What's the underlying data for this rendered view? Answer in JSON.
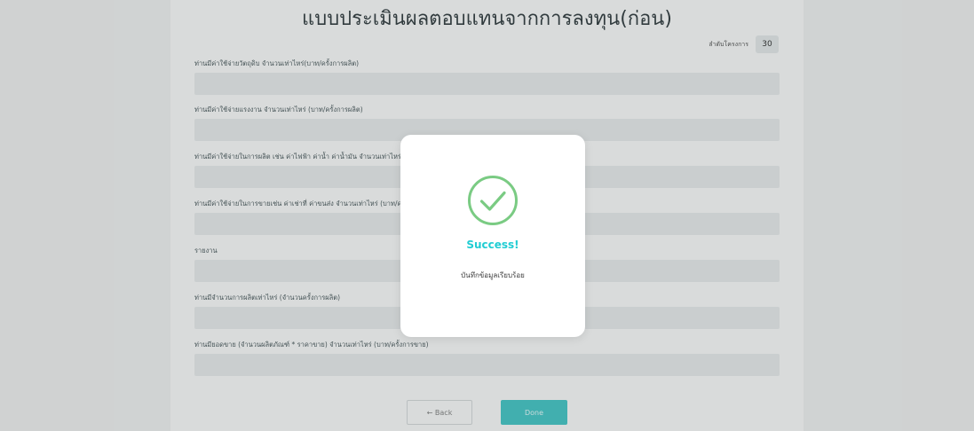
{
  "form": {
    "title": "แบบประเมินผลตอบแทนจากการลงทุน(ก่อน)",
    "order_label": "ลำดับโครงการ",
    "order_value": "30",
    "fields": [
      {
        "label": "ท่านมีค่าใช้จ่ายวัตถุดิบ จำนวนเท่าไหร่(บาท/ครั้งการผลิต)",
        "value": ""
      },
      {
        "label": "ท่านมีค่าใช้จ่ายแรงงาน จำนวนเท่าไหร่ (บาท/ครั้งการผลิต)",
        "value": ""
      },
      {
        "label": "ท่านมีค่าใช้จ่ายในการผลิต เช่น ค่าไฟฟ้า ค่าน้ำ ค่าน้ำมัน จำนวนเท่าไหร่ (บาท/ครั้งการผลิต)",
        "value": ""
      },
      {
        "label": "ท่านมีค่าใช้จ่ายในการขายเช่น ค่าเช่าที่ ค่าขนส่ง จำนวนเท่าไหร่ (บาท/ครั้งการขาย)",
        "value": ""
      },
      {
        "label": "รายงาน",
        "value": ""
      },
      {
        "label": "ท่านมีจำนวนการผลิตเท่าไหร่ (จำนวนครั้งการผลิต)",
        "value": ""
      },
      {
        "label": "ท่านมียอดขาย (จำนวนผลิตภัณฑ์ * ราคาขาย) จำนวนเท่าไหร่ (บาท/ครั้งการขาย)",
        "value": ""
      }
    ],
    "back_label": "← Back",
    "done_label": "Done"
  },
  "modal": {
    "icon": "check-circle-icon",
    "title": "Success!",
    "message": "บันทึกข้อมูลเรียบร้อย"
  },
  "colors": {
    "accent": "#35c4c5",
    "success_title": "#21cdd3",
    "success_icon": "#7acb83"
  }
}
